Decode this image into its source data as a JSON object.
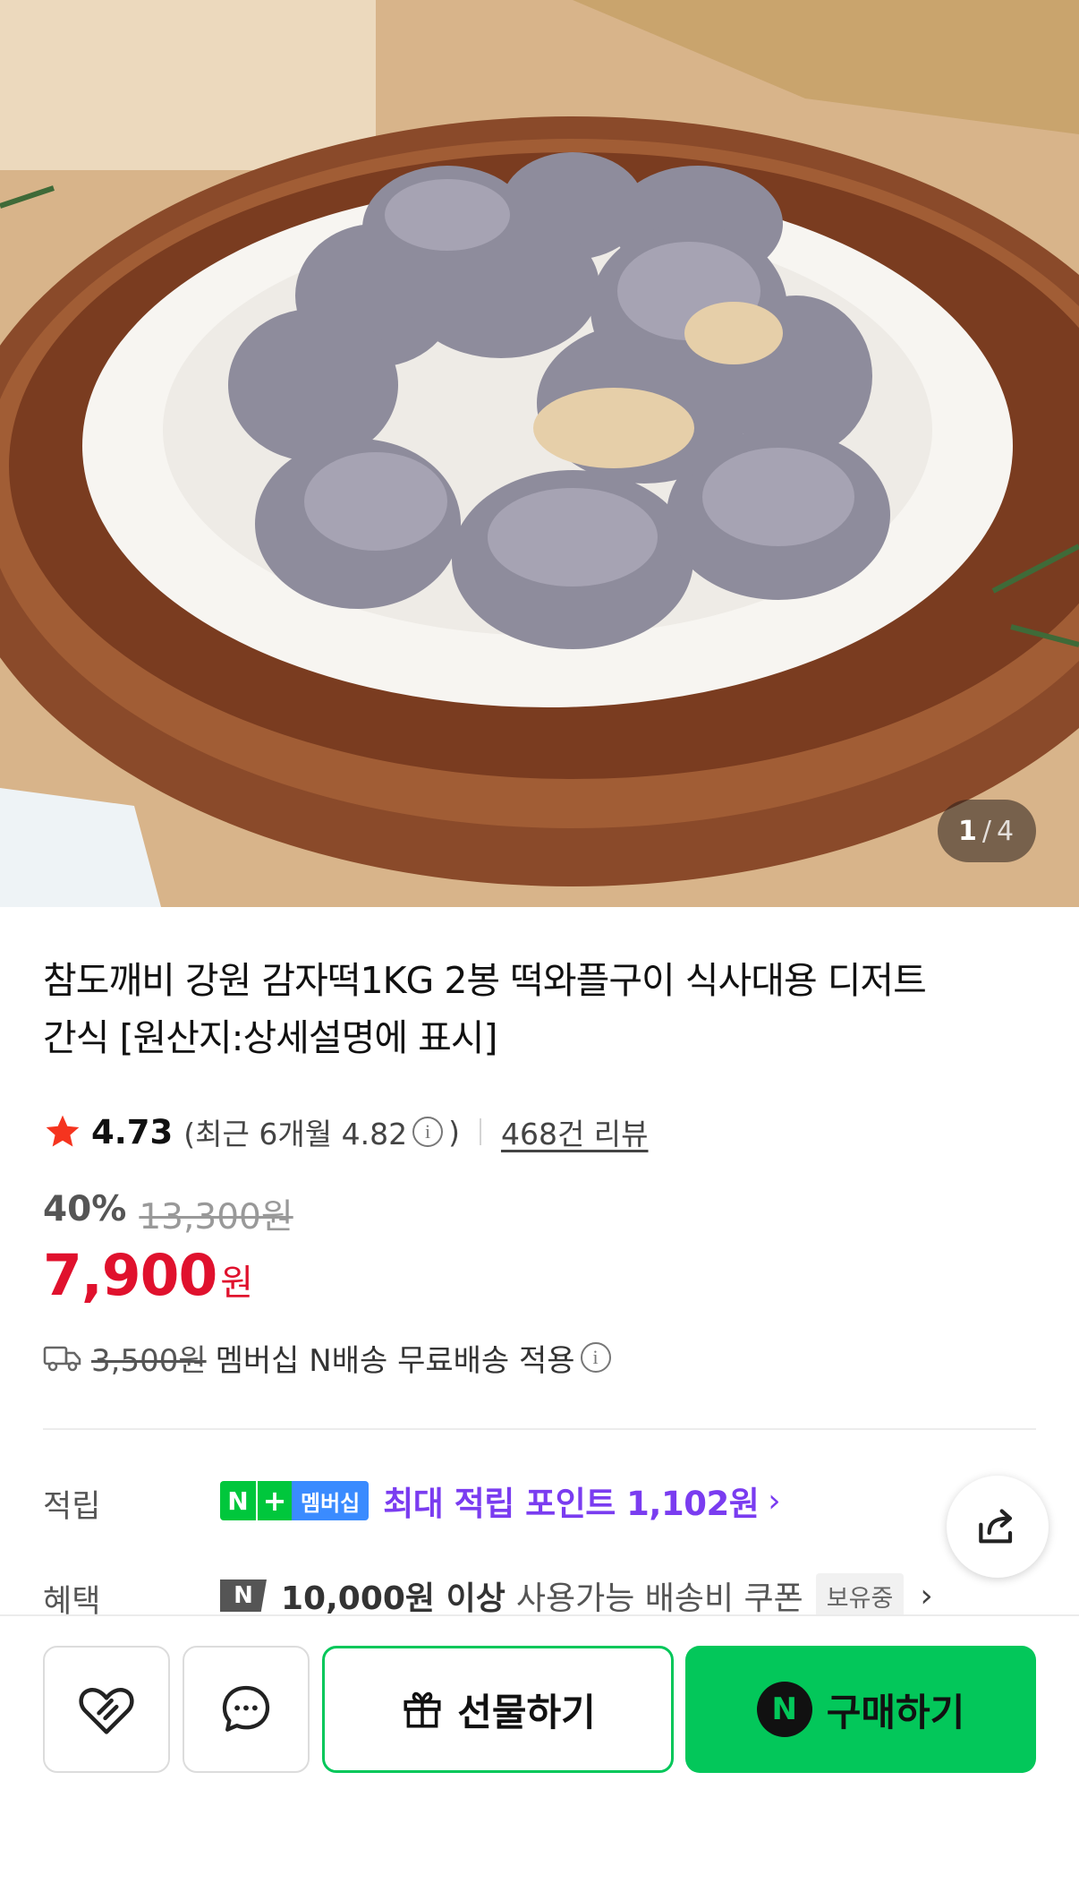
{
  "product_image": {
    "pager_current": "1",
    "pager_separator": "/",
    "pager_total": "4"
  },
  "product": {
    "title": "참도깨비 강원 감자떡1KG 2봉 떡와플구이 식사대용 디저트 간식 [원산지:상세설명에 표시]"
  },
  "rating": {
    "score": "4.73",
    "recent_prefix": "(최근 6개월 4.82",
    "recent_suffix": ")",
    "reviews": "468건 리뷰"
  },
  "price": {
    "discount": "40%",
    "original": "13,300원",
    "current": "7,900",
    "currency": "원"
  },
  "shipping": {
    "original_fee": "3,500원",
    "text": "멤버십 N배송 무료배송 적용"
  },
  "benefits": {
    "points_label": "적립",
    "badge_n": "N",
    "badge_plus": "+",
    "badge_member": "멤버십",
    "points_text": "최대 적립 포인트 1,102원",
    "benefit_label": "혜택",
    "coupon_badge": "N",
    "coupon_strong": "10,000원 이상",
    "coupon_text": "사용가능 배송비 쿠폰",
    "coupon_owned": "보유중"
  },
  "actions": {
    "gift_label": "선물하기",
    "buy_badge": "N",
    "buy_label": "구매하기"
  },
  "colors": {
    "price_red": "#e0112d",
    "naver_green": "#03c75a",
    "point_purple": "#7a3cf0"
  }
}
